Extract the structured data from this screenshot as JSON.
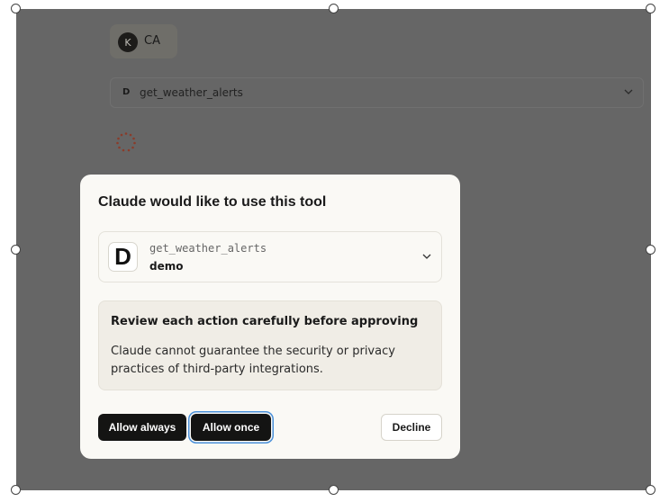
{
  "background": {
    "user_chip": {
      "avatar_initial": "K",
      "name": "CA"
    },
    "tool_row": {
      "badge": "D",
      "name": "get_weather_alerts",
      "chevron_icon": "chevron-down-icon"
    },
    "spinner_icon": "loading-spinner-icon"
  },
  "dialog": {
    "title": "Claude would like to use this tool",
    "tool": {
      "logo_letter": "D",
      "function_name": "get_weather_alerts",
      "server_name": "demo",
      "chevron_icon": "chevron-down-icon"
    },
    "warning": {
      "title": "Review each action carefully before approving",
      "body": "Claude cannot guarantee the security or privacy practices of third-party integrations."
    },
    "buttons": {
      "allow_always": "Allow always",
      "allow_once": "Allow once",
      "decline": "Decline"
    }
  },
  "colors": {
    "overlay": "#666666",
    "dialog_bg": "#faf9f5",
    "primary_button": "#141413",
    "focus_ring": "#4a90d9",
    "warning_bg": "#f0ede6"
  }
}
